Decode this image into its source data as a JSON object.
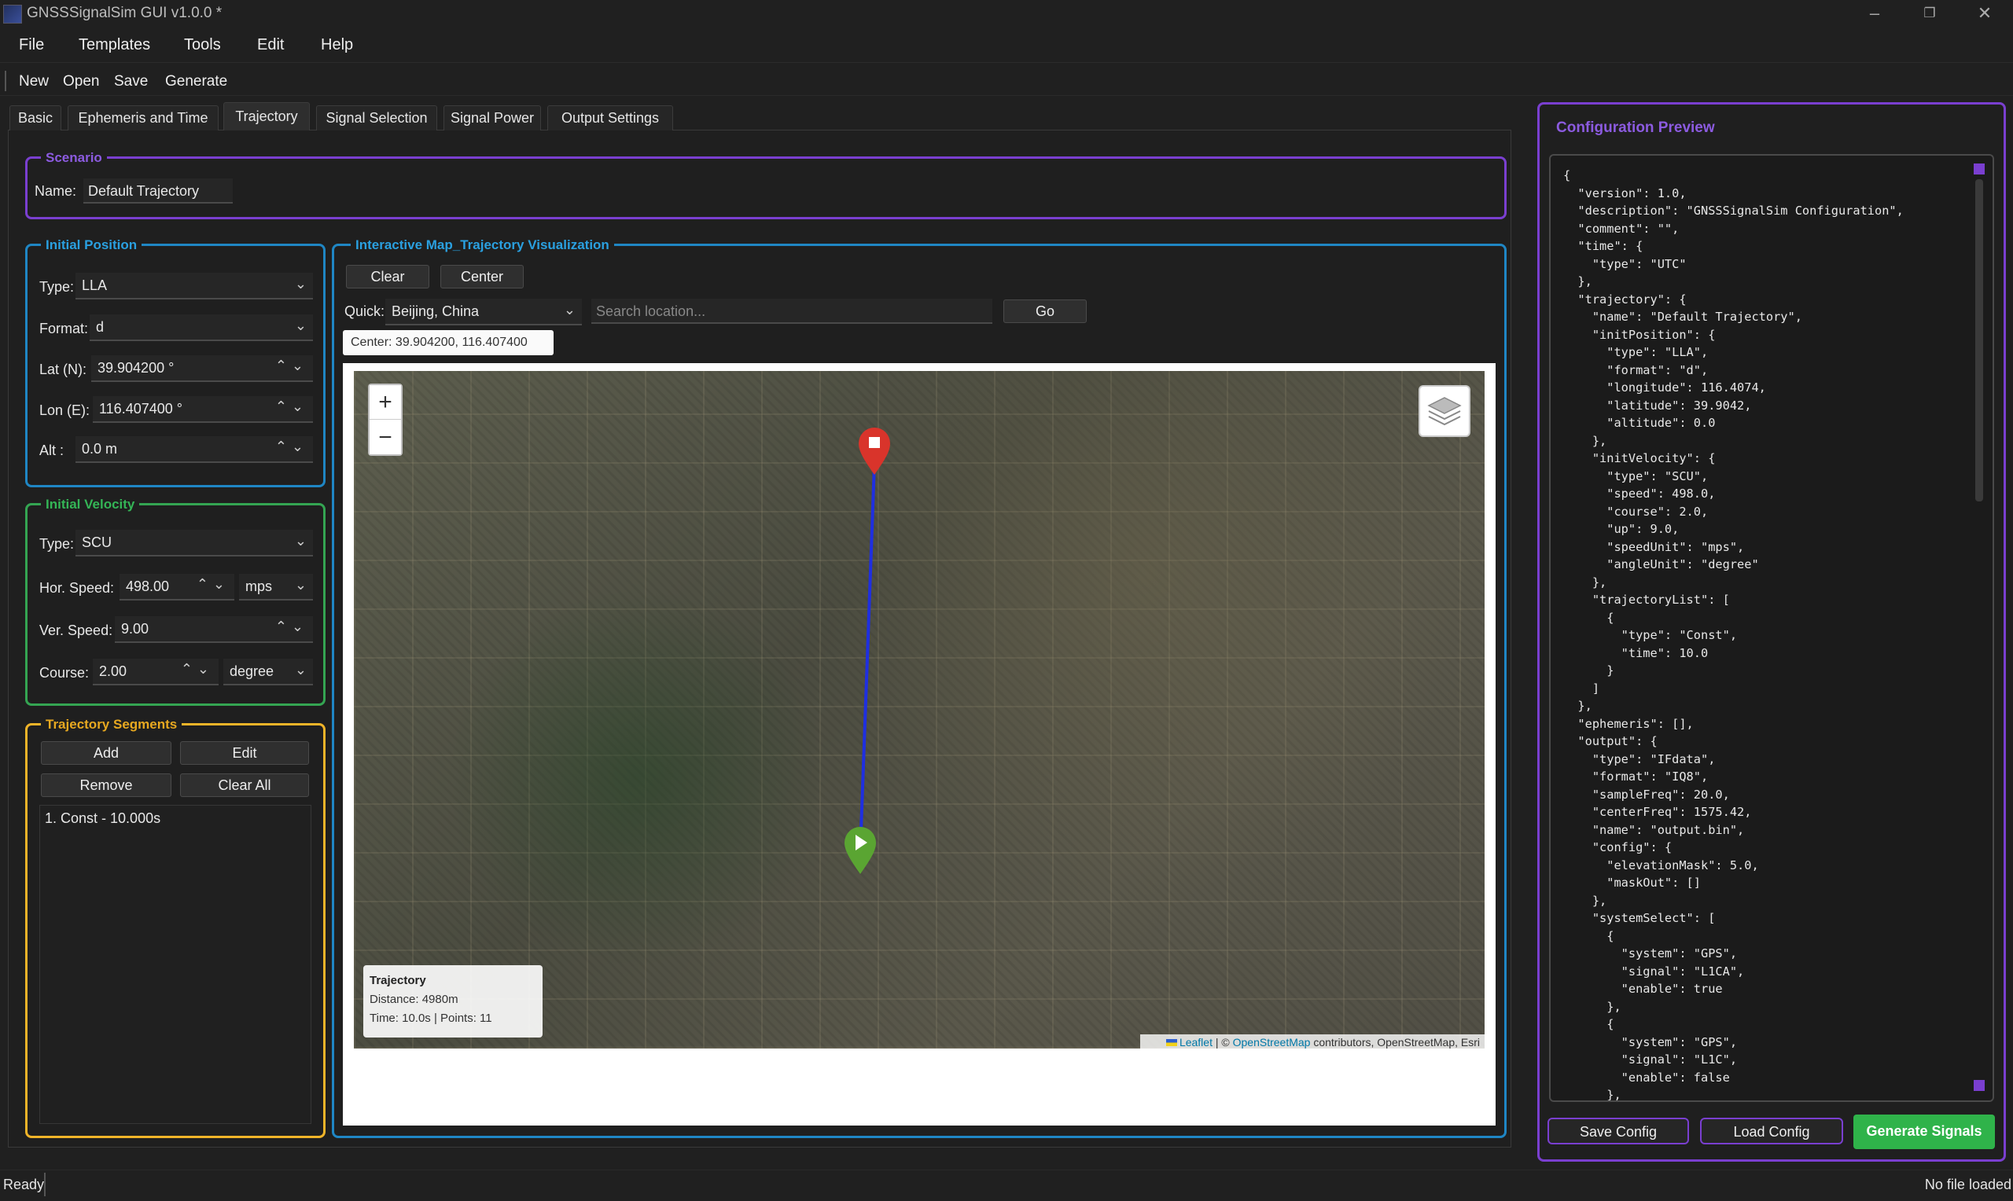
{
  "window": {
    "title": "GNSSSignalSim GUI v1.0.0 *"
  },
  "menu": [
    "File",
    "Templates",
    "Tools",
    "Edit",
    "Help"
  ],
  "toolbar": [
    "New",
    "Open",
    "Save",
    "Generate"
  ],
  "tabs": [
    {
      "label": "Basic",
      "active": false
    },
    {
      "label": "Ephemeris and Time",
      "active": false
    },
    {
      "label": "Trajectory",
      "active": true
    },
    {
      "label": "Signal Selection",
      "active": false
    },
    {
      "label": "Signal Power",
      "active": false
    },
    {
      "label": "Output Settings",
      "active": false
    }
  ],
  "scenario": {
    "title": "Scenario",
    "name_label": "Name:",
    "name_value": "Default Trajectory"
  },
  "initial_position": {
    "title": "Initial Position",
    "type_label": "Type:",
    "type_value": "LLA",
    "format_label": "Format:",
    "format_value": "d",
    "lat_label": "Lat (N):",
    "lat_value": "39.904200 °",
    "lon_label": "Lon (E):",
    "lon_value": "116.407400 °",
    "alt_label": "Alt :",
    "alt_value": "0.0 m"
  },
  "initial_velocity": {
    "title": "Initial Velocity",
    "type_label": "Type:",
    "type_value": "SCU",
    "hspeed_label": "Hor. Speed:",
    "hspeed_value": "498.00",
    "hspeed_unit": "mps",
    "vspeed_label": "Ver. Speed:",
    "vspeed_value": "9.00",
    "course_label": "Course:",
    "course_value": "2.00",
    "course_unit": "degree"
  },
  "segments": {
    "title": "Trajectory Segments",
    "add": "Add",
    "edit": "Edit",
    "remove": "Remove",
    "clear_all": "Clear All",
    "items": [
      "1. Const - 10.000s"
    ]
  },
  "map_panel": {
    "title": "Interactive Map_Trajectory Visualization",
    "clear": "Clear",
    "center": "Center",
    "quick_label": "Quick:",
    "quick_value": "Beijing, China",
    "search_placeholder": "Search location...",
    "go": "Go",
    "center_readout": "Center: 39.904200, 116.407400",
    "zoom_in": "+",
    "zoom_out": "−",
    "legend_title": "Trajectory",
    "legend_distance": "Distance: 4980m",
    "legend_time": "Time: 10.0s | Points: 11",
    "attribution_link1": "Leaflet",
    "attribution_sep": " | © ",
    "attribution_link2": "OpenStreetMap",
    "attribution_rest": " contributors, OpenStreetMap, Esri"
  },
  "config_preview": {
    "title": "Configuration Preview",
    "json_text": "{\n  \"version\": 1.0,\n  \"description\": \"GNSSSignalSim Configuration\",\n  \"comment\": \"\",\n  \"time\": {\n    \"type\": \"UTC\"\n  },\n  \"trajectory\": {\n    \"name\": \"Default Trajectory\",\n    \"initPosition\": {\n      \"type\": \"LLA\",\n      \"format\": \"d\",\n      \"longitude\": 116.4074,\n      \"latitude\": 39.9042,\n      \"altitude\": 0.0\n    },\n    \"initVelocity\": {\n      \"type\": \"SCU\",\n      \"speed\": 498.0,\n      \"course\": 2.0,\n      \"up\": 9.0,\n      \"speedUnit\": \"mps\",\n      \"angleUnit\": \"degree\"\n    },\n    \"trajectoryList\": [\n      {\n        \"type\": \"Const\",\n        \"time\": 10.0\n      }\n    ]\n  },\n  \"ephemeris\": [],\n  \"output\": {\n    \"type\": \"IFdata\",\n    \"format\": \"IQ8\",\n    \"sampleFreq\": 20.0,\n    \"centerFreq\": 1575.42,\n    \"name\": \"output.bin\",\n    \"config\": {\n      \"elevationMask\": 5.0,\n      \"maskOut\": []\n    },\n    \"systemSelect\": [\n      {\n        \"system\": \"GPS\",\n        \"signal\": \"L1CA\",\n        \"enable\": true\n      },\n      {\n        \"system\": \"GPS\",\n        \"signal\": \"L1C\",\n        \"enable\": false\n      },",
    "save_config": "Save Config",
    "load_config": "Load Config",
    "generate_signals": "Generate Signals"
  },
  "status": {
    "left": "Ready",
    "right": "No file loaded"
  },
  "colors": {
    "accent_green": "#2fb34a",
    "route": "#1f2fe0",
    "start_marker": "#5aa532",
    "end_marker": "#d9342b"
  }
}
